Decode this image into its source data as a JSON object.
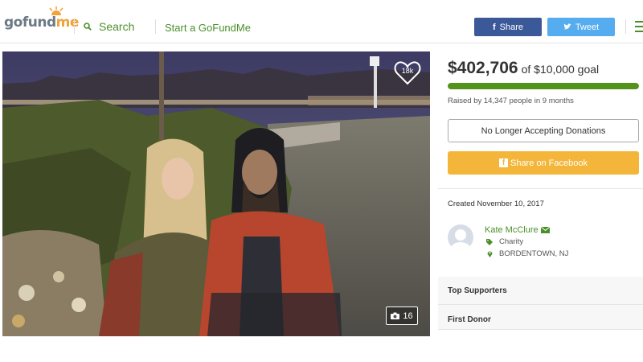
{
  "header": {
    "logo_part1": "gofund",
    "logo_part2": "me",
    "search_label": "Search",
    "start_label": "Start a GoFundMe",
    "share_label": "Share",
    "tweet_label": "Tweet"
  },
  "colors": {
    "brand_green": "#53921b",
    "link_green": "#4a8f2a",
    "facebook_blue": "#3b5998",
    "twitter_blue": "#55acee",
    "share_orange": "#f4b63a"
  },
  "photo": {
    "likes_count": "18k",
    "photo_count": "16"
  },
  "campaign": {
    "raised_amount": "$402,706",
    "goal_text": "of $10,000 goal",
    "progress_fraction": 1.0,
    "raised_by": "Raised by 14,347 people in 9 months",
    "no_longer_label": "No Longer Accepting Donations",
    "share_facebook_label": "Share on Facebook",
    "created": "Created November 10, 2017"
  },
  "organizer": {
    "name": "Kate McClure",
    "category": "Charity",
    "location": "BORDENTOWN, NJ"
  },
  "sections": {
    "top_supporters": "Top Supporters",
    "first_donor": "First Donor"
  }
}
